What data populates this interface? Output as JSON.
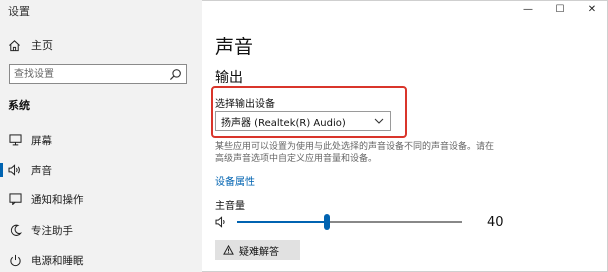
{
  "app_title": "设置",
  "sidebar": {
    "home_label": "主页",
    "search_placeholder": "查找设置",
    "section_title": "系统",
    "items": [
      {
        "label": "屏幕",
        "icon": "monitor-icon"
      },
      {
        "label": "声音",
        "icon": "speaker-icon",
        "active": true
      },
      {
        "label": "通知和操作",
        "icon": "notification-icon"
      },
      {
        "label": "专注助手",
        "icon": "moon-icon"
      },
      {
        "label": "电源和睡眠",
        "icon": "power-icon"
      }
    ]
  },
  "window_controls": {
    "minimize": "—",
    "maximize": "☐",
    "close": "✕"
  },
  "main": {
    "title": "声音",
    "output_heading": "输出",
    "choose_device_label": "选择输出设备",
    "selected_device": "扬声器 (Realtek(R) Audio)",
    "description": "某些应用可以设置为使用与此处选择的声音设备不同的声音设备。请在高级声音选项中自定义应用音量和设备。",
    "device_properties_link": "设备属性",
    "master_volume_label": "主音量",
    "volume_value": "40",
    "volume_fraction": 0.4,
    "troubleshoot_label": "疑难解答"
  },
  "colors": {
    "accent": "#0063b1",
    "highlight_border": "#d9352b",
    "sidebar_bg": "#f2f2f2"
  }
}
